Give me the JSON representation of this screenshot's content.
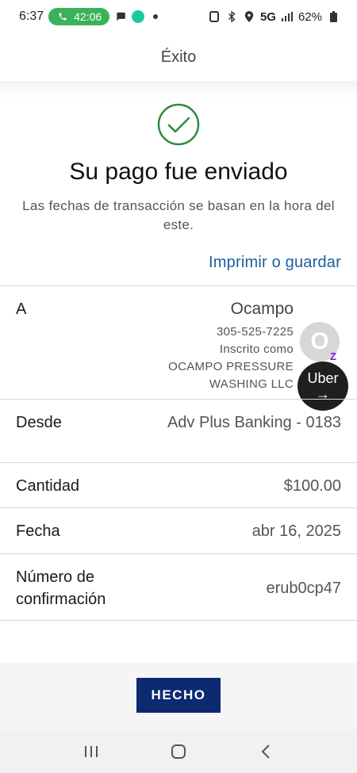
{
  "status_bar": {
    "time": "6:37",
    "call_timer": "42:06",
    "network": "5G",
    "battery": "62%"
  },
  "header": {
    "title": "Éxito"
  },
  "success": {
    "title": "Su pago fue enviado",
    "subtitle": "Las fechas de transacción se basan en la hora del este.",
    "print_link": "Imprimir o guardar"
  },
  "details": {
    "to": {
      "label": "A",
      "name": "Ocampo",
      "phone": "305-525-7225",
      "enrolled_label": "Inscrito como",
      "enrolled_name_line1": "OCAMPO PRESSURE",
      "enrolled_name_line2": "WASHING LLC"
    },
    "from": {
      "label": "Desde",
      "value": "Adv Plus Banking - 0183"
    },
    "amount": {
      "label": "Cantidad",
      "value": "$100.00"
    },
    "date": {
      "label": "Fecha",
      "value": "abr 16, 2025"
    },
    "confirmation": {
      "label_line1": "Número de",
      "label_line2": "confirmación",
      "value": "erub0cp47"
    }
  },
  "floating": {
    "avatar_letter": "O",
    "zelle_mark": "Z",
    "uber_label": "Uber",
    "uber_arrow": "→"
  },
  "done_button": "HECHO",
  "colors": {
    "accent_link": "#1b5fa0",
    "button_bg": "#0b2a6f",
    "success_green": "#2e8b3d",
    "call_pill": "#3bb25a"
  }
}
